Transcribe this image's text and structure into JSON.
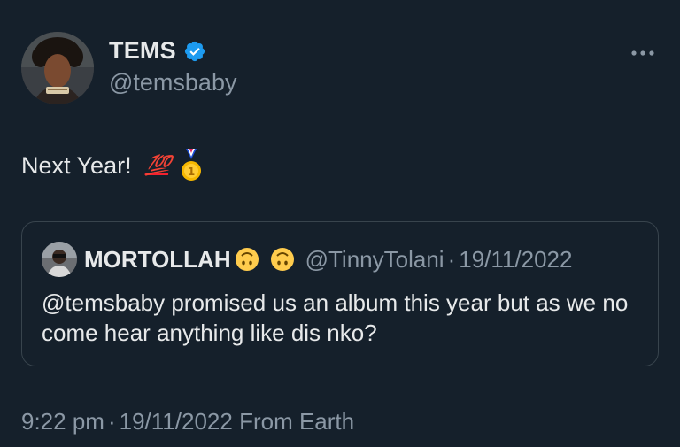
{
  "tweet": {
    "author": {
      "display_name": "TEMS",
      "handle": "@temsbaby",
      "verified": true
    },
    "text": "Next Year!",
    "emoji_100": "💯",
    "quote": {
      "author_name": "MORTOLLAH",
      "author_handle": "@TinnyTolani",
      "separator": "·",
      "date": "19/11/2022",
      "text": "@temsbaby promised us an album this year but as we no come hear anything like dis nko?"
    },
    "meta": {
      "time": "9:22 pm",
      "separator": "·",
      "date": "19/11/2022",
      "source": "From Earth"
    }
  },
  "icons": {
    "verified": "verified-badge-icon",
    "more": "more-horizontal-icon",
    "medal": "first-place-medal-icon",
    "upside_down": "upside-down-face-icon"
  },
  "colors": {
    "background": "#15202b",
    "primary_text": "#e7e9ea",
    "secondary_text": "#8b98a5",
    "verified_blue": "#1d9bf0",
    "border": "#38444d",
    "hundred_red": "#f4212e",
    "medal_gold": "#f5b700"
  }
}
